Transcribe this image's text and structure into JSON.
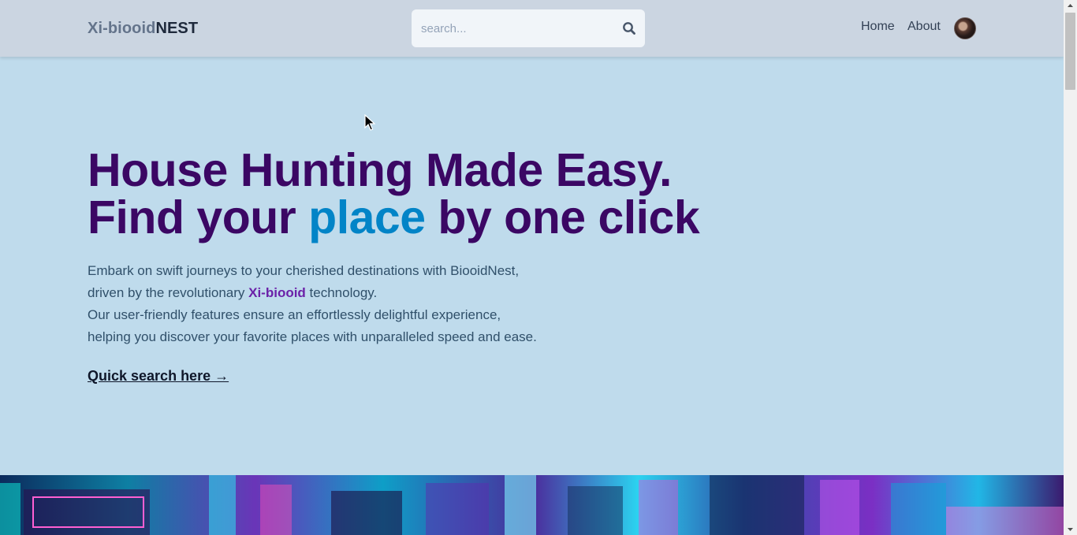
{
  "header": {
    "logo_prefix": "Xi-biooid",
    "logo_suffix": "NEST",
    "search_placeholder": "search...",
    "nav_home": "Home",
    "nav_about": "About"
  },
  "hero": {
    "title_line1": "House Hunting Made Easy.",
    "title_line2_part1": "Find your ",
    "title_line2_accent": "place",
    "title_line2_part2": " by one click",
    "desc_line1": "Embark on swift journeys to your cherished destinations with BiooidNest,",
    "desc_line2_part1": "driven by the revolutionary ",
    "desc_line2_brand": "Xi-biooid",
    "desc_line2_part2": " technology.",
    "desc_line3": "Our user-friendly features ensure an effortlessly delightful experience,",
    "desc_line4": "helping you discover your favorite places with unparalleled speed and ease.",
    "quick_link": "Quick search here →"
  },
  "icons": {
    "search": "search-icon",
    "avatar": "avatar",
    "cursor": "mouse-cursor-icon"
  },
  "colors": {
    "page_bg": "#bfdbec",
    "header_bg": "#cbd5e1",
    "title": "#3b0764",
    "accent": "#0284c7",
    "brand": "#6b21a8"
  }
}
